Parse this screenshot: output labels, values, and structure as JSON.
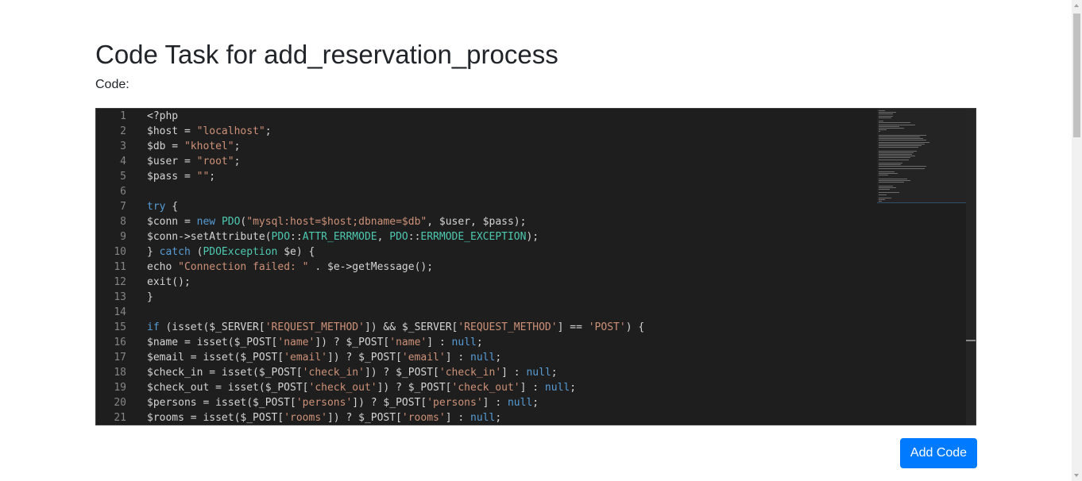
{
  "page": {
    "title": "Code Task for add_reservation_process",
    "code_label": "Code:",
    "submit_label": "Add Code"
  },
  "theme": {
    "keyword": "#569cd6",
    "string": "#ce9178",
    "class": "#4ec9b0",
    "text": "#d4d4d4",
    "line_number": "#858585",
    "editor_bg": "#1e1e1e",
    "button": "#007bff"
  },
  "editor": {
    "lines": [
      {
        "n": "1",
        "t": [
          [
            "<?php",
            "p"
          ]
        ]
      },
      {
        "n": "2",
        "t": [
          [
            "$host = ",
            "p"
          ],
          [
            "\"localhost\"",
            "s"
          ],
          [
            ";",
            "p"
          ]
        ]
      },
      {
        "n": "3",
        "t": [
          [
            "$db = ",
            "p"
          ],
          [
            "\"khotel\"",
            "s"
          ],
          [
            ";",
            "p"
          ]
        ]
      },
      {
        "n": "4",
        "t": [
          [
            "$user = ",
            "p"
          ],
          [
            "\"root\"",
            "s"
          ],
          [
            ";",
            "p"
          ]
        ]
      },
      {
        "n": "5",
        "t": [
          [
            "$pass = ",
            "p"
          ],
          [
            "\"\"",
            "s"
          ],
          [
            ";",
            "p"
          ]
        ]
      },
      {
        "n": "6",
        "t": []
      },
      {
        "n": "7",
        "t": [
          [
            "try",
            "k"
          ],
          [
            " {",
            "p"
          ]
        ]
      },
      {
        "n": "8",
        "t": [
          [
            "$conn = ",
            "p"
          ],
          [
            "new",
            "k"
          ],
          [
            " ",
            "p"
          ],
          [
            "PDO",
            "c"
          ],
          [
            "(",
            "p"
          ],
          [
            "\"mysql:host=$host;dbname=$db\"",
            "s"
          ],
          [
            ", $user, $pass);",
            "p"
          ]
        ]
      },
      {
        "n": "9",
        "t": [
          [
            "$conn->setAttribute(",
            "p"
          ],
          [
            "PDO",
            "c"
          ],
          [
            "::",
            "p"
          ],
          [
            "ATTR_ERRMODE",
            "c"
          ],
          [
            ", ",
            "p"
          ],
          [
            "PDO",
            "c"
          ],
          [
            "::",
            "p"
          ],
          [
            "ERRMODE_EXCEPTION",
            "c"
          ],
          [
            ");",
            "p"
          ]
        ]
      },
      {
        "n": "10",
        "t": [
          [
            "} ",
            "p"
          ],
          [
            "catch",
            "k"
          ],
          [
            " (",
            "p"
          ],
          [
            "PDOException",
            "c"
          ],
          [
            " $e) {",
            "p"
          ]
        ]
      },
      {
        "n": "11",
        "t": [
          [
            "echo ",
            "p"
          ],
          [
            "\"Connection failed: \"",
            "s"
          ],
          [
            " . $e->getMessage();",
            "p"
          ]
        ]
      },
      {
        "n": "12",
        "t": [
          [
            "exit();",
            "p"
          ]
        ]
      },
      {
        "n": "13",
        "t": [
          [
            "}",
            "p"
          ]
        ]
      },
      {
        "n": "14",
        "t": []
      },
      {
        "n": "15",
        "t": [
          [
            "if",
            "k"
          ],
          [
            " (isset($_SERVER[",
            "p"
          ],
          [
            "'REQUEST_METHOD'",
            "s"
          ],
          [
            "]) && $_SERVER[",
            "p"
          ],
          [
            "'REQUEST_METHOD'",
            "s"
          ],
          [
            "] == ",
            "p"
          ],
          [
            "'POST'",
            "s"
          ],
          [
            ") {",
            "p"
          ]
        ]
      },
      {
        "n": "16",
        "t": [
          [
            "$name = isset($_POST[",
            "p"
          ],
          [
            "'name'",
            "s"
          ],
          [
            "]) ? $_POST[",
            "p"
          ],
          [
            "'name'",
            "s"
          ],
          [
            "] : ",
            "p"
          ],
          [
            "null",
            "k"
          ],
          [
            ";",
            "p"
          ]
        ]
      },
      {
        "n": "17",
        "t": [
          [
            "$email = isset($_POST[",
            "p"
          ],
          [
            "'email'",
            "s"
          ],
          [
            "]) ? $_POST[",
            "p"
          ],
          [
            "'email'",
            "s"
          ],
          [
            "] : ",
            "p"
          ],
          [
            "null",
            "k"
          ],
          [
            ";",
            "p"
          ]
        ]
      },
      {
        "n": "18",
        "t": [
          [
            "$check_in = isset($_POST[",
            "p"
          ],
          [
            "'check_in'",
            "s"
          ],
          [
            "]) ? $_POST[",
            "p"
          ],
          [
            "'check_in'",
            "s"
          ],
          [
            "] : ",
            "p"
          ],
          [
            "null",
            "k"
          ],
          [
            ";",
            "p"
          ]
        ]
      },
      {
        "n": "19",
        "t": [
          [
            "$check_out = isset($_POST[",
            "p"
          ],
          [
            "'check_out'",
            "s"
          ],
          [
            "]) ? $_POST[",
            "p"
          ],
          [
            "'check_out'",
            "s"
          ],
          [
            "] : ",
            "p"
          ],
          [
            "null",
            "k"
          ],
          [
            ";",
            "p"
          ]
        ]
      },
      {
        "n": "20",
        "t": [
          [
            "$persons = isset($_POST[",
            "p"
          ],
          [
            "'persons'",
            "s"
          ],
          [
            "]) ? $_POST[",
            "p"
          ],
          [
            "'persons'",
            "s"
          ],
          [
            "] : ",
            "p"
          ],
          [
            "null",
            "k"
          ],
          [
            ";",
            "p"
          ]
        ]
      },
      {
        "n": "21",
        "t": [
          [
            "$rooms = isset($_POST[",
            "p"
          ],
          [
            "'rooms'",
            "s"
          ],
          [
            "]) ? $_POST[",
            "p"
          ],
          [
            "'rooms'",
            "s"
          ],
          [
            "] : ",
            "p"
          ],
          [
            "null",
            "k"
          ],
          [
            ";",
            "p"
          ]
        ]
      }
    ]
  }
}
